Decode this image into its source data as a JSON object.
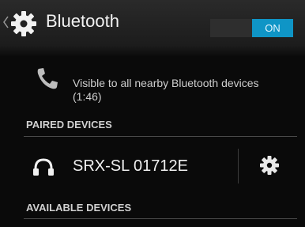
{
  "header": {
    "title": "Bluetooth",
    "toggle_state": "ON",
    "icons": {
      "back": "chevron-left-icon",
      "settings": "gear-icon"
    }
  },
  "visibility": {
    "text": "Visible to all nearby Bluetooth devices",
    "timer": "(1:46)",
    "icon": "phone-icon"
  },
  "sections": {
    "paired": "PAIRED DEVICES",
    "available": "AVAILABLE DEVICES"
  },
  "paired_devices": [
    {
      "name": "SRX-SL 01712E",
      "icon": "headphones-icon",
      "settings_icon": "gear-icon"
    }
  ],
  "colors": {
    "accent": "#0f95c6",
    "background": "#0a0a0a"
  }
}
